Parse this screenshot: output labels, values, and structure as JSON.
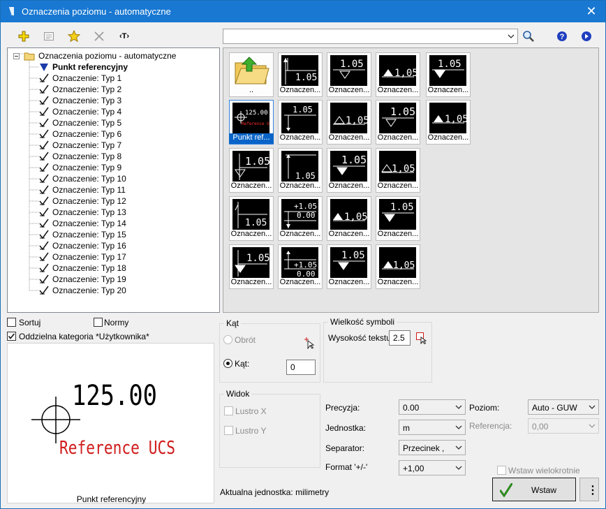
{
  "window": {
    "title": "Oznaczenia poziomu - automatyczne",
    "close_glyph": "✕"
  },
  "toolbar": {
    "icons": [
      "add-icon",
      "properties-icon",
      "favorite-star-icon",
      "delete-icon",
      "text-tag-icon"
    ],
    "text_tag_label": "‹T›"
  },
  "search": {
    "value": ""
  },
  "tree": {
    "root": "Oznaczenia poziomu - automatyczne",
    "selected": "Punkt referencyjny",
    "items": [
      "Oznaczenie: Typ 1",
      "Oznaczenie: Typ 2",
      "Oznaczenie: Typ 3",
      "Oznaczenie: Typ 4",
      "Oznaczenie: Typ 5",
      "Oznaczenie: Typ 6",
      "Oznaczenie: Typ 7",
      "Oznaczenie: Typ 8",
      "Oznaczenie: Typ 9",
      "Oznaczenie: Typ 10",
      "Oznaczenie: Typ 11",
      "Oznaczenie: Typ 12",
      "Oznaczenie: Typ 13",
      "Oznaczenie: Typ 14",
      "Oznaczenie: Typ 15",
      "Oznaczenie: Typ 16",
      "Oznaczenie: Typ 17",
      "Oznaczenie: Typ 18",
      "Oznaczenie: Typ 19",
      "Oznaczenie: Typ 20"
    ]
  },
  "gallery": {
    "folder_up": "..",
    "tile_caption": "Oznaczen...",
    "selected_caption": "Punkt ref...",
    "thumb_value": "1,05",
    "thumb_value_dot": "1.05",
    "thumb_plus": "+1.05",
    "thumb_zero": "0.00",
    "ref_value": "125.00",
    "ref_sub": "Reference UCS"
  },
  "options": {
    "sortuj": "Sortuj",
    "normy": "Normy",
    "oddzielna": "Oddzielna kategoria *Użytkownika*",
    "oddzielna_checked": true
  },
  "preview": {
    "value": "125.00",
    "sub": "Reference UCS",
    "caption": "Punkt referencyjny",
    "colors": {
      "text": "#000000",
      "sub": "#d01c1c"
    }
  },
  "kat": {
    "title": "Kąt",
    "obrot": "Obrót",
    "kat_label": "Kąt:",
    "kat_value": "0"
  },
  "wielkosc": {
    "title": "Wielkość symboli",
    "wysokosc_label": "Wysokość tekstu",
    "wysokosc_value": "2.5"
  },
  "widok": {
    "title": "Widok",
    "lustro_x": "Lustro X",
    "lustro_y": "Lustro Y"
  },
  "fields": {
    "precyzja_label": "Precyzja:",
    "precyzja_value": "0.00",
    "jednostka_label": "Jednostka:",
    "jednostka_value": "m",
    "separator_label": "Separator:",
    "separator_value": "Przecinek ,",
    "format_label": "Format '+/-'",
    "format_value": "+1,00",
    "poziom_label": "Poziom:",
    "poziom_value": "Auto - GUW",
    "referencja_label": "Referencja:",
    "referencja_value": "0,00"
  },
  "status": {
    "aktualna": "Aktualna jednostka: milimetry"
  },
  "wstaw_wielokrotnie": "Wstaw wielokrotnie",
  "wstaw_button": "Wstaw",
  "more_glyph": "⋮",
  "colors": {
    "titlebar": "#1878d2",
    "selection": "#0a64c8",
    "accent_yellow": "#f5c400",
    "help_blue": "#1f3fbf"
  }
}
